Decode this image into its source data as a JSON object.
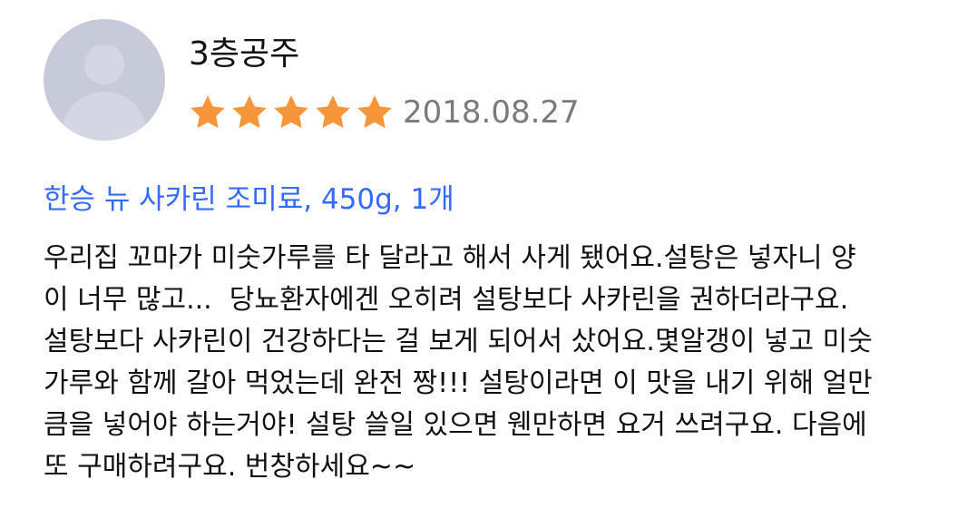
{
  "review": {
    "username": "3층공주",
    "rating": 5,
    "rating_max": 5,
    "date": "2018.08.27",
    "product": "한승 뉴 사카린 조미료, 450g, 1개",
    "content_lines": [
      "우리집 꼬마가 미숫가루를 타 달라고 해서 사게 됐어요.설탕은 넣자니 양",
      "이 너무 많고...  당뇨환자에겐 오히려 설탕보다 사카린을 권하더라구요.",
      "설탕보다 사카린이 건강하다는 걸 보게 되어서 샀어요.몇알갱이 넣고 미숫",
      "가루와 함께 갈아 먹었는데 완전 짱!!! 설탕이라면 이 맛을 내기 위해 얼만",
      "큼을 넣어야 하는거야! 설탕 쓸일 있으면 웬만하면 요거 쓰려구요. 다음에",
      "또 구매하려구요. 번창하세요~~"
    ]
  },
  "colors": {
    "star": "#f6953a",
    "product_link": "#346aff",
    "date": "#7a7a7a",
    "avatar_bg": "#c7cbd9"
  },
  "icons": {
    "avatar": "default-user-avatar-icon",
    "star": "star-icon"
  }
}
